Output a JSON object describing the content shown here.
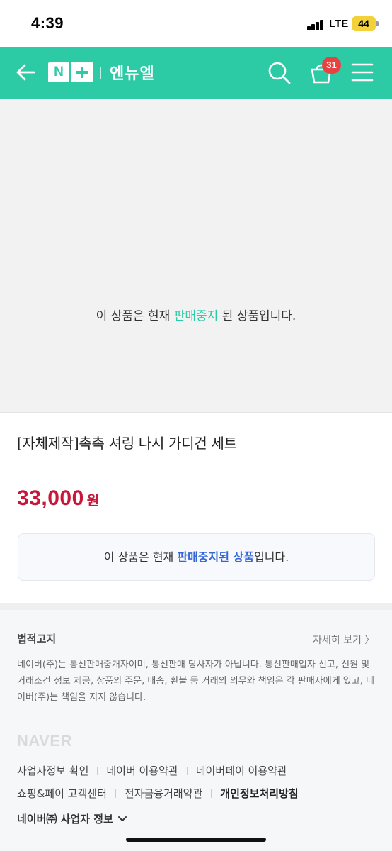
{
  "status_bar": {
    "time": "4:39",
    "network": "LTE",
    "battery": "44"
  },
  "header": {
    "logo_n": "N",
    "store_name": "엔뉴엘",
    "cart_count": "31",
    "accent": "#2ccba6"
  },
  "image_area": {
    "msg_prefix": "이 상품은 현재 ",
    "msg_highlight": "판매중지",
    "msg_suffix": " 된 상품입니다."
  },
  "product": {
    "title": "[자체제작]촉촉 셔링 나시 가디건 세트",
    "price": "33,000",
    "price_unit": "원",
    "price_color": "#c7173a"
  },
  "notice": {
    "prefix": "이 상품은 현재 ",
    "highlight": "판매중지된 상품",
    "suffix": "입니다."
  },
  "footer": {
    "legal_title": "법적고지",
    "legal_more": "자세히 보기 〉",
    "legal_text": "네이버(주)는 통신판매중개자이며, 통신판매 당사자가 아닙니다. 통신판매업자 신고, 신원 및 거래조건 정보 제공, 상품의 주문, 배송, 환불 등 거래의 의무와 책임은 각 판매자에게 있고, 네이버(주)는 책임을 지지 않습니다.",
    "naver_logo": "NAVER",
    "links_row1": [
      "사업자정보 확인",
      "네이버 이용약관",
      "네이버페이 이용약관"
    ],
    "links_row2": [
      "쇼핑&페이 고객센터",
      "전자금융거래약관",
      "개인정보처리방침"
    ],
    "business_info": "네이버㈜ 사업자 정보"
  }
}
